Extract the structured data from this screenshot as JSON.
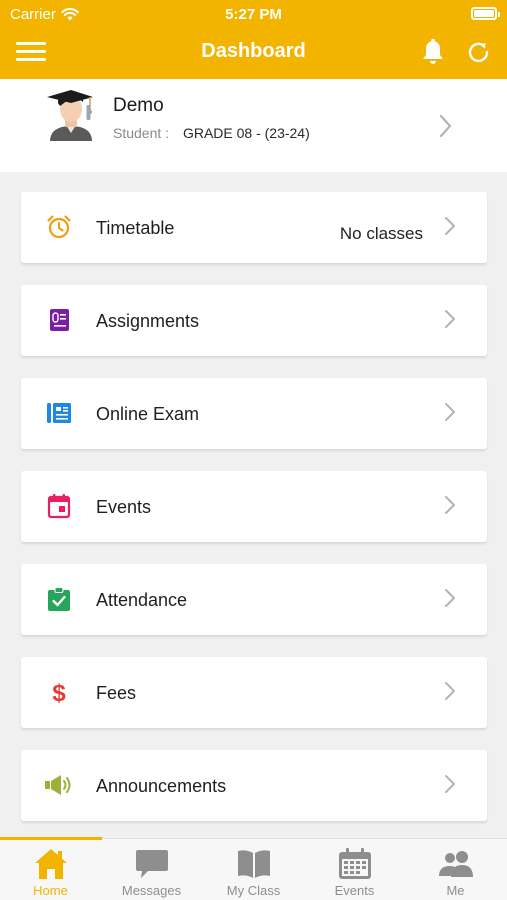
{
  "status_bar": {
    "carrier": "Carrier",
    "time": "5:27 PM"
  },
  "header": {
    "title": "Dashboard"
  },
  "profile": {
    "name": "Demo",
    "role_label": "Student :",
    "grade": "GRADE 08 - (23-24)"
  },
  "menu": [
    {
      "label": "Timetable",
      "value": "No classes",
      "icon": "alarm-clock-icon",
      "color": "#f39c12"
    },
    {
      "label": "Assignments",
      "value": "",
      "icon": "assignment-book-icon",
      "color": "#7b1fa2"
    },
    {
      "label": "Online Exam",
      "value": "",
      "icon": "exam-document-icon",
      "color": "#1e88e5"
    },
    {
      "label": "Events",
      "value": "",
      "icon": "calendar-icon",
      "color": "#e91e63"
    },
    {
      "label": "Attendance",
      "value": "",
      "icon": "clipboard-check-icon",
      "color": "#26a65b"
    },
    {
      "label": "Fees",
      "value": "",
      "icon": "dollar-icon",
      "color": "#e53935"
    },
    {
      "label": "Announcements",
      "value": "",
      "icon": "megaphone-icon",
      "color": "#9bb23a"
    }
  ],
  "tabs": [
    {
      "label": "Home",
      "icon": "home-icon",
      "active": true
    },
    {
      "label": "Messages",
      "icon": "chat-icon",
      "active": false
    },
    {
      "label": "My Class",
      "icon": "book-icon",
      "active": false
    },
    {
      "label": "Events",
      "icon": "calendar-icon",
      "active": false
    },
    {
      "label": "Me",
      "icon": "people-icon",
      "active": false
    }
  ],
  "colors": {
    "accent": "#f3b400",
    "background": "#f0f0f0",
    "inactive_tab": "#8e8e8e"
  }
}
